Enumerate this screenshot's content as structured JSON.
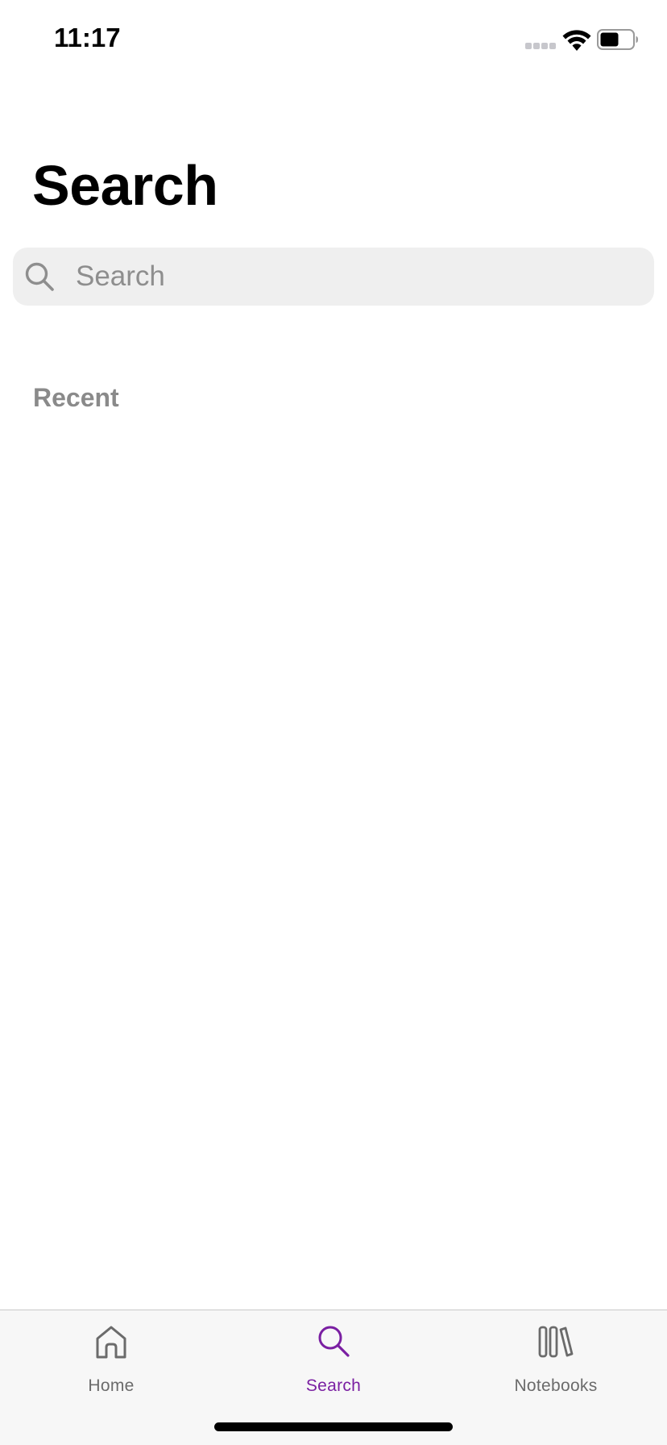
{
  "status_bar": {
    "time": "11:17",
    "signal_icon": "cellular-signal-icon",
    "wifi_icon": "wifi-icon",
    "battery_icon": "battery-icon",
    "battery_level": 0.55
  },
  "header": {
    "title": "Search"
  },
  "search": {
    "placeholder": "Search",
    "value": "",
    "icon": "search-icon"
  },
  "recent": {
    "label": "Recent",
    "items": []
  },
  "tab_bar": {
    "tabs": [
      {
        "label": "Home",
        "icon": "home-icon",
        "active": false
      },
      {
        "label": "Search",
        "icon": "search-icon",
        "active": true
      },
      {
        "label": "Notebooks",
        "icon": "notebooks-icon",
        "active": false
      }
    ]
  },
  "colors": {
    "accent": "#7a1fa2",
    "inactive": "#6b6b6b",
    "search_field_bg": "#efefef",
    "tab_bar_bg": "#f7f7f7"
  }
}
